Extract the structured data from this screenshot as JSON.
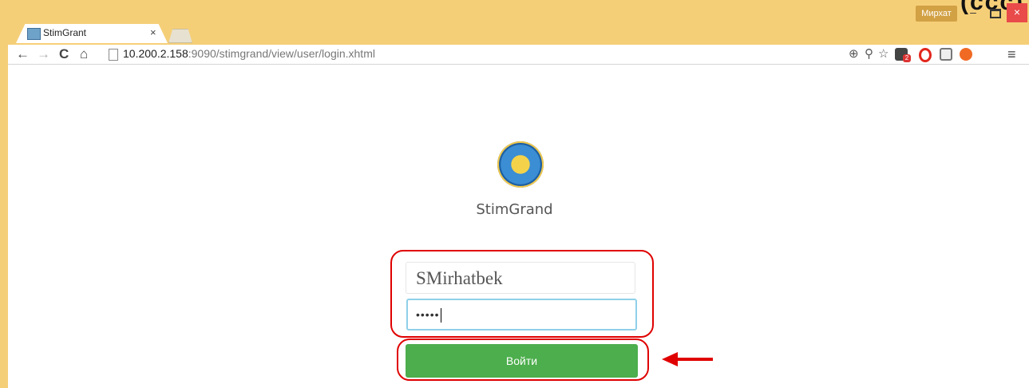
{
  "window": {
    "corner_text": "(ccc)",
    "user_chip": "Мирхат",
    "minimize_label": "–",
    "close_label": "×"
  },
  "tab": {
    "title": "StimGrant",
    "close_label": "×"
  },
  "toolbar": {
    "back_label": "←",
    "forward_label": "→",
    "reload_label": "C",
    "home_label": "⌂",
    "url_host": "10.200.2.158",
    "url_rest": ":9090/stimgrand/view/user/login.xhtml",
    "zoom_icon": "⊕",
    "key_icon": "⚲",
    "star_icon": "☆",
    "menu_icon": "≡",
    "ext_badge": "2"
  },
  "login": {
    "app_name": "StimGrand",
    "username_value": "SMirhatbek",
    "password_value": "•••••",
    "submit_label": "Войти"
  },
  "colors": {
    "frame": "#f5cf78",
    "button": "#4cae4c",
    "annotation": "#e00000"
  }
}
